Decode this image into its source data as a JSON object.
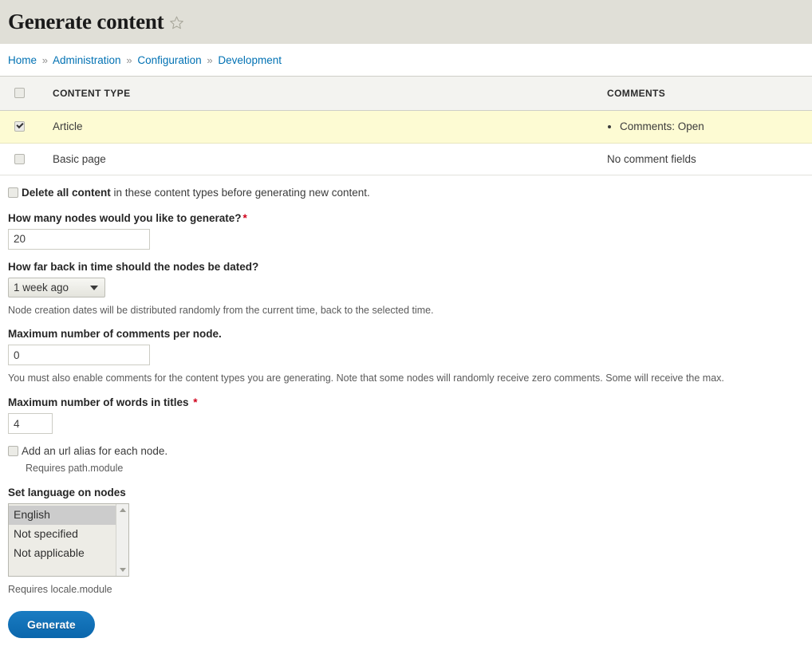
{
  "header": {
    "title": "Generate content",
    "star_icon": "star-outline-icon"
  },
  "breadcrumb": {
    "separator": "»",
    "items": [
      {
        "label": "Home"
      },
      {
        "label": "Administration"
      },
      {
        "label": "Configuration"
      },
      {
        "label": "Development"
      }
    ]
  },
  "table": {
    "columns": {
      "select_all": "",
      "content_type": "CONTENT TYPE",
      "comments": "COMMENTS"
    },
    "rows": [
      {
        "checked": true,
        "selected": true,
        "content_type": "Article",
        "comments_items": [
          "Comments: Open"
        ],
        "comments_text": ""
      },
      {
        "checked": false,
        "selected": false,
        "content_type": "Basic page",
        "comments_items": [],
        "comments_text": "No comment fields"
      }
    ]
  },
  "form": {
    "delete_all": {
      "checked": false,
      "label_strong": "Delete all content",
      "label_rest": " in these content types before generating new content."
    },
    "node_count": {
      "label": "How many nodes would you like to generate?",
      "required_marker": "*",
      "value": "20"
    },
    "time_back": {
      "label": "How far back in time should the nodes be dated?",
      "selected": "1 week ago",
      "description": "Node creation dates will be distributed randomly from the current time, back to the selected time."
    },
    "max_comments": {
      "label": "Maximum number of comments per node.",
      "value": "0",
      "description": "You must also enable comments for the content types you are generating. Note that some nodes will randomly receive zero comments. Some will receive the max."
    },
    "max_words": {
      "label": "Maximum number of words in titles",
      "required_marker": "*",
      "value": "4"
    },
    "url_alias": {
      "checked": false,
      "label": "Add an url alias for each node.",
      "description": "Requires path.module"
    },
    "language": {
      "label": "Set language on nodes",
      "options": [
        {
          "label": "English",
          "selected": true
        },
        {
          "label": "Not specified",
          "selected": false
        },
        {
          "label": "Not applicable",
          "selected": false
        }
      ],
      "description": "Requires locale.module"
    },
    "submit_label": "Generate"
  },
  "colors": {
    "header_band": "#e0dfd7",
    "link": "#0071b3",
    "row_highlight": "#fdfbd3",
    "required": "#d0021b",
    "button": "#0d6fb8"
  }
}
